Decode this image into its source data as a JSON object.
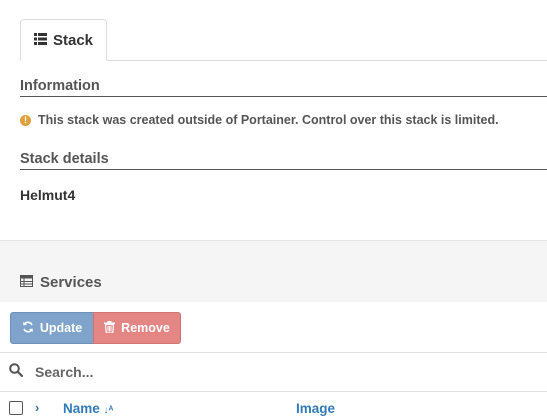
{
  "tab": {
    "label": "Stack",
    "icon": "list-icon"
  },
  "information": {
    "title": "Information",
    "warning_text": "This stack was created outside of Portainer. Control over this stack is limited.",
    "warning_icon": "exclamation-circle-icon",
    "warning_color": "#e0a03d"
  },
  "stack_details": {
    "title": "Stack details",
    "name": "Helmut4"
  },
  "services": {
    "title": "Services",
    "icon": "table-icon",
    "update_label": "Update",
    "remove_label": "Remove",
    "update_color": "#7fa3cb",
    "remove_color": "#e48683",
    "search_placeholder": "Search...",
    "columns": {
      "name": "Name",
      "name_sort_icon": "sort-alpha-asc-icon",
      "image": "Image"
    }
  }
}
